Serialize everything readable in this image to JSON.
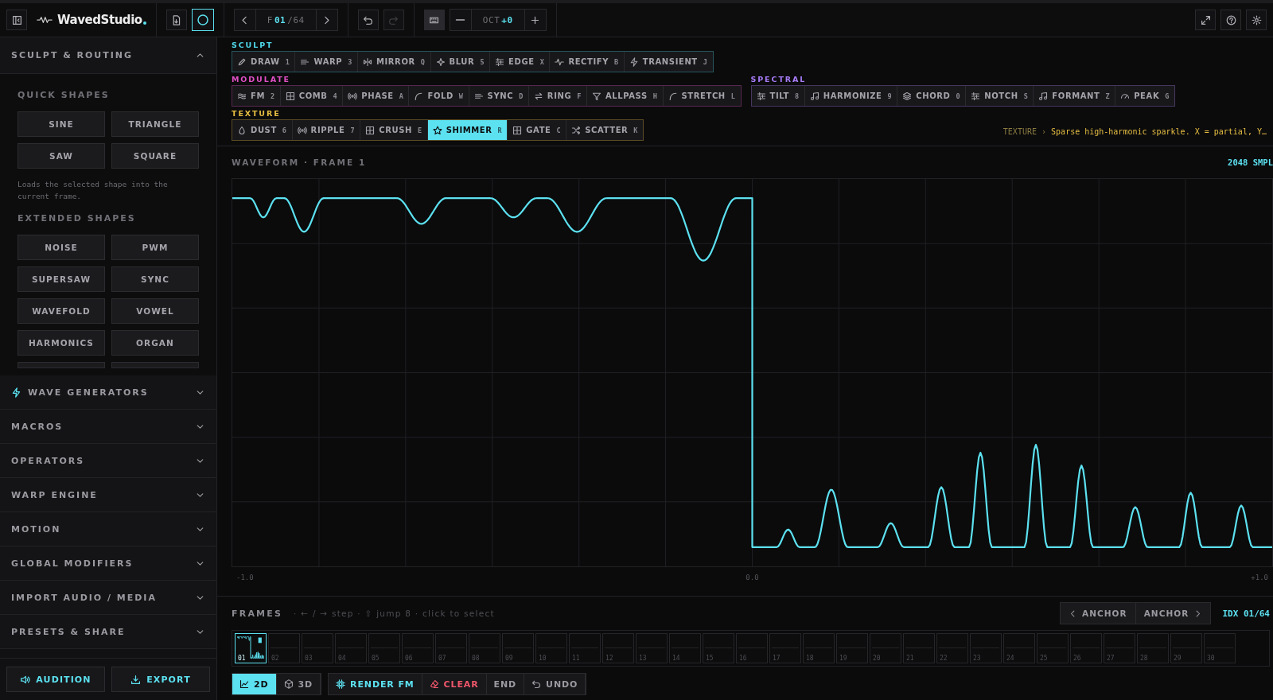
{
  "top_bar": {
    "logo": "WavedStudio",
    "frame_prefix": "F",
    "frame_current": "01",
    "frame_total": "/64",
    "octave_label": "OCT",
    "octave_value": "+0",
    "circle_toggle": {
      "on": true
    },
    "keyboard_toggle": {
      "on": true
    },
    "redo": {
      "disabled": true
    }
  },
  "sidebar": {
    "sections": [
      {
        "title": "SCULPT & ROUTING",
        "expanded": true,
        "icon": false
      },
      {
        "title": "WAVE GENERATORS",
        "expanded": false,
        "icon": true
      },
      {
        "title": "MACROS",
        "expanded": false,
        "icon": false
      },
      {
        "title": "OPERATORS",
        "expanded": false,
        "icon": false
      },
      {
        "title": "WARP ENGINE",
        "expanded": false,
        "icon": false
      },
      {
        "title": "MOTION",
        "expanded": false,
        "icon": false
      },
      {
        "title": "GLOBAL MODIFIERS",
        "expanded": false,
        "icon": false
      },
      {
        "title": "IMPORT AUDIO / MEDIA",
        "expanded": false,
        "icon": false
      },
      {
        "title": "PRESETS & SHARE",
        "expanded": false,
        "icon": false
      }
    ],
    "quick_shapes_title": "QUICK SHAPES",
    "quick_shapes": [
      "SINE",
      "TRIANGLE",
      "SAW",
      "SQUARE"
    ],
    "quick_shapes_note": "Loads the selected shape into the current frame.",
    "extended_shapes_title": "EXTENDED SHAPES",
    "extended_shapes": [
      "NOISE",
      "PWM",
      "SUPERSAW",
      "SYNC",
      "WAVEFOLD",
      "VOWEL",
      "HARMONICS",
      "ORGAN"
    ],
    "footer_buttons": [
      "AUDITION",
      "EXPORT"
    ]
  },
  "tool_groups": [
    {
      "name": "SCULPT",
      "color": "#4fd8ea",
      "tools": [
        {
          "label": "DRAW",
          "key": "1",
          "selected": false
        },
        {
          "label": "WARP",
          "key": "3",
          "selected": false
        },
        {
          "label": "MIRROR",
          "key": "Q",
          "selected": false
        },
        {
          "label": "BLUR",
          "key": "5",
          "selected": false
        },
        {
          "label": "EDGE",
          "key": "X",
          "selected": false
        },
        {
          "label": "RECTIFY",
          "key": "B",
          "selected": false
        },
        {
          "label": "TRANSIENT",
          "key": "J",
          "selected": false
        }
      ]
    },
    {
      "name": "MODULATE",
      "color": "#e04fc4",
      "tools": [
        {
          "label": "FM",
          "key": "2",
          "selected": false
        },
        {
          "label": "COMB",
          "key": "4",
          "selected": false
        },
        {
          "label": "PHASE",
          "key": "A",
          "selected": false
        },
        {
          "label": "FOLD",
          "key": "W",
          "selected": false
        },
        {
          "label": "SYNC",
          "key": "D",
          "selected": false
        },
        {
          "label": "RING",
          "key": "F",
          "selected": false
        },
        {
          "label": "ALLPASS",
          "key": "H",
          "selected": false
        },
        {
          "label": "STRETCH",
          "key": "L",
          "selected": false
        }
      ]
    },
    {
      "name": "SPECTRAL",
      "color": "#a77cf6",
      "tools": [
        {
          "label": "TILT",
          "key": "8",
          "selected": false
        },
        {
          "label": "HARMONIZE",
          "key": "9",
          "selected": false
        },
        {
          "label": "CHORD",
          "key": "0",
          "selected": false
        },
        {
          "label": "NOTCH",
          "key": "S",
          "selected": false
        },
        {
          "label": "FORMANT",
          "key": "Z",
          "selected": false
        },
        {
          "label": "PEAK",
          "key": "G",
          "selected": false
        }
      ]
    },
    {
      "name": "TEXTURE",
      "color": "#e6be42",
      "tools": [
        {
          "label": "DUST",
          "key": "6",
          "selected": false
        },
        {
          "label": "RIPPLE",
          "key": "7",
          "selected": false
        },
        {
          "label": "CRUSH",
          "key": "E",
          "selected": false
        },
        {
          "label": "SHIMMER",
          "key": "R",
          "selected": true
        },
        {
          "label": "GATE",
          "key": "C",
          "selected": false
        },
        {
          "label": "SCATTER",
          "key": "K",
          "selected": false
        }
      ]
    }
  ],
  "tool_hint": {
    "category": "TEXTURE",
    "separator": "›",
    "text": "Sparse high-harmonic sparkle. X = partial, Y…"
  },
  "waveform": {
    "title": "WAVEFORM · FRAME 1",
    "samples": "2048 SMPL",
    "axis_labels": [
      "-1.0",
      "0.0",
      "+1.0"
    ]
  },
  "frames": {
    "title": "FRAMES",
    "hint": "· ← / → step · ⇧ jump 8 · click to select",
    "anchor_buttons": [
      "ANCHOR",
      "ANCHOR"
    ],
    "index": "IDX 01/64",
    "thumbs": [
      {
        "label": "01",
        "selected": true
      },
      {
        "label": "02",
        "selected": false
      },
      {
        "label": "03",
        "selected": false
      },
      {
        "label": "04",
        "selected": false
      },
      {
        "label": "05",
        "selected": false
      },
      {
        "label": "06",
        "selected": false
      },
      {
        "label": "07",
        "selected": false
      },
      {
        "label": "08",
        "selected": false
      },
      {
        "label": "09",
        "selected": false
      },
      {
        "label": "10",
        "selected": false
      },
      {
        "label": "11",
        "selected": false
      },
      {
        "label": "12",
        "selected": false
      },
      {
        "label": "13",
        "selected": false
      },
      {
        "label": "14",
        "selected": false
      },
      {
        "label": "15",
        "selected": false
      },
      {
        "label": "16",
        "selected": false
      },
      {
        "label": "17",
        "selected": false
      },
      {
        "label": "18",
        "selected": false
      },
      {
        "label": "19",
        "selected": false
      },
      {
        "label": "20",
        "selected": false
      },
      {
        "label": "21",
        "selected": false
      },
      {
        "label": "22",
        "selected": false
      },
      {
        "label": "23",
        "selected": false
      },
      {
        "label": "24",
        "selected": false
      },
      {
        "label": "25",
        "selected": false
      },
      {
        "label": "26",
        "selected": false
      },
      {
        "label": "27",
        "selected": false
      },
      {
        "label": "28",
        "selected": false
      },
      {
        "label": "29",
        "selected": false
      },
      {
        "label": "30",
        "selected": false
      }
    ]
  },
  "view_modes": [
    {
      "label": "2D",
      "selected": true
    },
    {
      "label": "3D",
      "selected": false
    }
  ],
  "actions": [
    {
      "label": "RENDER FM",
      "kind": "render"
    },
    {
      "label": "CLEAR",
      "kind": "clear"
    },
    {
      "label": "END",
      "kind": "plain"
    },
    {
      "label": "UNDO",
      "kind": "undo"
    }
  ]
}
